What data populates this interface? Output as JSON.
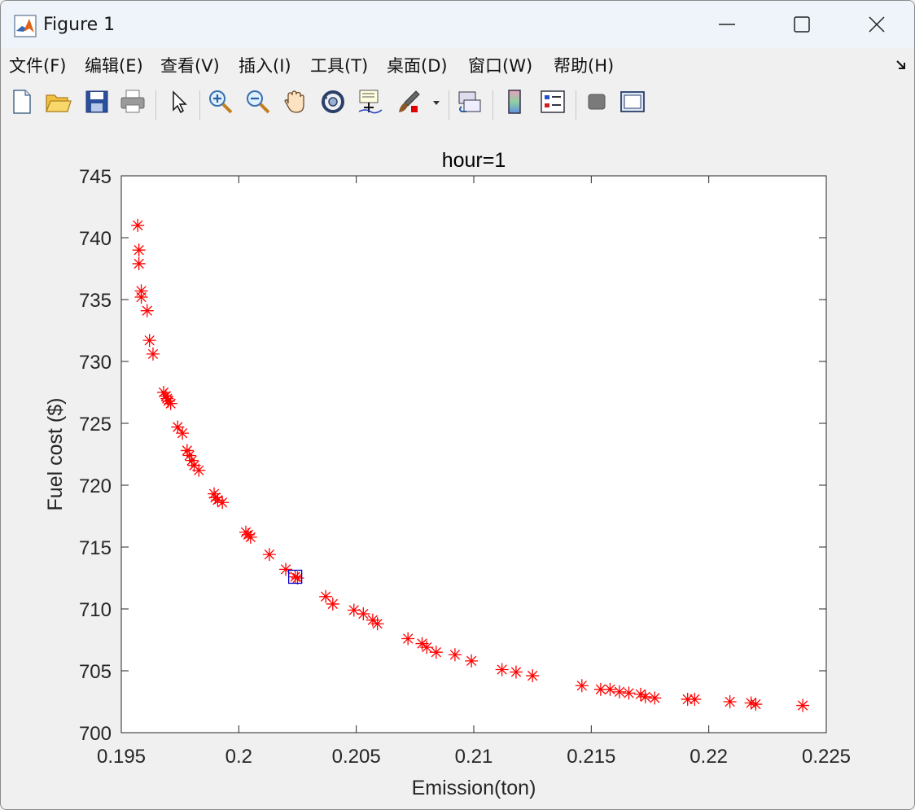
{
  "window": {
    "title": "Figure 1"
  },
  "menu": [
    {
      "label": "文件(F)"
    },
    {
      "label": "编辑(E)"
    },
    {
      "label": "查看(V)"
    },
    {
      "label": "插入(I)"
    },
    {
      "label": "工具(T)"
    },
    {
      "label": "桌面(D)"
    },
    {
      "label": "窗口(W)"
    },
    {
      "label": "帮助(H)"
    }
  ],
  "toolbar": [
    "new-figure-icon",
    "open-file-icon",
    "save-icon",
    "print-icon",
    "select-pointer-icon",
    "zoom-in-icon",
    "zoom-out-icon",
    "pan-hand-icon",
    "rotate-3d-icon",
    "data-cursor-icon",
    "brush-icon",
    "link-plot-icon",
    "colorbar-icon",
    "legend-icon",
    "hide-plot-tools-icon",
    "show-plot-tools-icon"
  ],
  "chart_data": {
    "type": "scatter",
    "title": "hour=1",
    "xlabel": "Emission(ton)",
    "ylabel": "Fuel cost ($)",
    "xlim": [
      0.195,
      0.225
    ],
    "ylim": [
      700,
      745
    ],
    "xticks": [
      "0.195",
      "0.2",
      "0.205",
      "0.21",
      "0.215",
      "0.22",
      "0.225"
    ],
    "yticks": [
      "700",
      "705",
      "710",
      "715",
      "720",
      "725",
      "730",
      "735",
      "740",
      "745"
    ],
    "grid": false,
    "colors": {
      "points": "#ff0000",
      "highlight": "#0000cc"
    },
    "series": [
      {
        "marker": "asterisk",
        "points": [
          [
            0.1957,
            741.0
          ],
          [
            0.19575,
            739.0
          ],
          [
            0.19575,
            737.9
          ],
          [
            0.19585,
            735.7
          ],
          [
            0.19585,
            735.2
          ],
          [
            0.1961,
            734.1
          ],
          [
            0.1962,
            731.7
          ],
          [
            0.19635,
            730.6
          ],
          [
            0.1968,
            727.5
          ],
          [
            0.1969,
            727.2
          ],
          [
            0.19695,
            727.0
          ],
          [
            0.197,
            726.8
          ],
          [
            0.1971,
            726.6
          ],
          [
            0.1974,
            724.7
          ],
          [
            0.1976,
            724.2
          ],
          [
            0.1978,
            722.8
          ],
          [
            0.1979,
            722.4
          ],
          [
            0.198,
            722.0
          ],
          [
            0.1981,
            721.6
          ],
          [
            0.1983,
            721.2
          ],
          [
            0.19895,
            719.3
          ],
          [
            0.199,
            719.0
          ],
          [
            0.1991,
            718.8
          ],
          [
            0.1993,
            718.6
          ],
          [
            0.2003,
            716.2
          ],
          [
            0.2004,
            716.0
          ],
          [
            0.2005,
            715.8
          ],
          [
            0.2013,
            714.4
          ],
          [
            0.202,
            713.2
          ],
          [
            0.2024,
            712.6
          ],
          [
            0.2025,
            712.5
          ],
          [
            0.2037,
            711.0
          ],
          [
            0.204,
            710.4
          ],
          [
            0.2049,
            709.9
          ],
          [
            0.2053,
            709.6
          ],
          [
            0.2057,
            709.1
          ],
          [
            0.2059,
            708.8
          ],
          [
            0.2072,
            707.6
          ],
          [
            0.2078,
            707.2
          ],
          [
            0.208,
            706.9
          ],
          [
            0.2084,
            706.5
          ],
          [
            0.2092,
            706.3
          ],
          [
            0.2099,
            705.8
          ],
          [
            0.2112,
            705.1
          ],
          [
            0.2118,
            704.9
          ],
          [
            0.2125,
            704.6
          ],
          [
            0.2146,
            703.8
          ],
          [
            0.2154,
            703.5
          ],
          [
            0.2158,
            703.5
          ],
          [
            0.2162,
            703.3
          ],
          [
            0.2166,
            703.2
          ],
          [
            0.2171,
            703.1
          ],
          [
            0.2173,
            702.9
          ],
          [
            0.2177,
            702.8
          ],
          [
            0.2191,
            702.7
          ],
          [
            0.2194,
            702.7
          ],
          [
            0.2209,
            702.5
          ],
          [
            0.2218,
            702.4
          ],
          [
            0.222,
            702.3
          ],
          [
            0.224,
            702.2
          ]
        ]
      },
      {
        "marker": "square",
        "points": [
          [
            0.2024,
            712.6
          ]
        ]
      }
    ]
  }
}
